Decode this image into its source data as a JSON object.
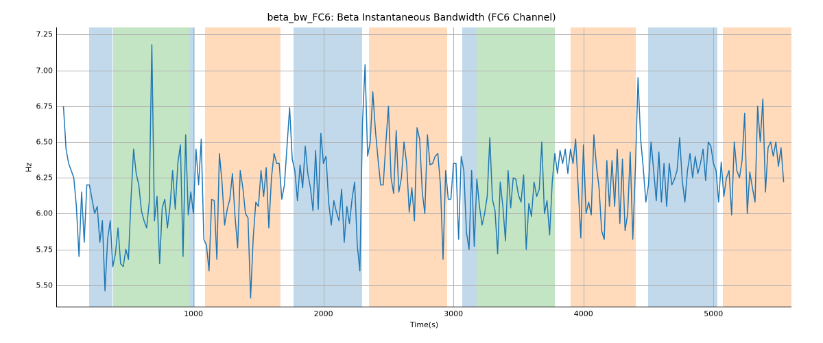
{
  "chart_data": {
    "type": "line",
    "title": "beta_bw_FC6: Beta Instantaneous Bandwidth (FC6 Channel)",
    "xlabel": "Time(s)",
    "ylabel": "Hz",
    "xlim": [
      -50,
      5600
    ],
    "ylim": [
      5.35,
      7.3
    ],
    "xticks": [
      1000,
      2000,
      3000,
      4000,
      5000
    ],
    "yticks": [
      5.5,
      5.75,
      6.0,
      6.25,
      6.5,
      6.75,
      7.0,
      7.25
    ],
    "bands": [
      {
        "color": "blue",
        "x0": 200,
        "x1": 380
      },
      {
        "color": "green",
        "x0": 380,
        "x1": 970
      },
      {
        "color": "blue",
        "x0": 970,
        "x1": 1010
      },
      {
        "color": "orange",
        "x0": 1090,
        "x1": 1670
      },
      {
        "color": "blue",
        "x0": 1770,
        "x1": 2300
      },
      {
        "color": "orange",
        "x0": 2350,
        "x1": 2950
      },
      {
        "color": "blue",
        "x0": 3070,
        "x1": 3180
      },
      {
        "color": "green",
        "x0": 3180,
        "x1": 3780
      },
      {
        "color": "orange",
        "x0": 3900,
        "x1": 4400
      },
      {
        "color": "blue",
        "x0": 4500,
        "x1": 5030
      },
      {
        "color": "orange",
        "x0": 5070,
        "x1": 5600
      }
    ],
    "series": [
      {
        "name": "beta_bw_FC6",
        "x": [
          0,
          20,
          40,
          60,
          80,
          100,
          120,
          140,
          160,
          180,
          200,
          220,
          240,
          260,
          280,
          300,
          320,
          340,
          360,
          380,
          400,
          420,
          440,
          460,
          480,
          500,
          520,
          540,
          560,
          580,
          600,
          620,
          640,
          660,
          680,
          700,
          720,
          740,
          760,
          780,
          800,
          820,
          840,
          860,
          880,
          900,
          920,
          940,
          960,
          980,
          1000,
          1020,
          1040,
          1060,
          1080,
          1100,
          1120,
          1140,
          1160,
          1180,
          1200,
          1220,
          1240,
          1260,
          1280,
          1300,
          1320,
          1340,
          1360,
          1380,
          1400,
          1420,
          1440,
          1460,
          1480,
          1500,
          1520,
          1540,
          1560,
          1580,
          1600,
          1620,
          1640,
          1660,
          1680,
          1700,
          1720,
          1740,
          1760,
          1780,
          1800,
          1820,
          1840,
          1860,
          1880,
          1900,
          1920,
          1940,
          1960,
          1980,
          2000,
          2020,
          2040,
          2060,
          2080,
          2100,
          2120,
          2140,
          2160,
          2180,
          2200,
          2220,
          2240,
          2260,
          2280,
          2300,
          2320,
          2340,
          2360,
          2380,
          2400,
          2420,
          2440,
          2460,
          2480,
          2500,
          2520,
          2540,
          2560,
          2580,
          2600,
          2620,
          2640,
          2660,
          2680,
          2700,
          2720,
          2740,
          2760,
          2780,
          2800,
          2820,
          2840,
          2860,
          2880,
          2900,
          2920,
          2940,
          2960,
          2980,
          3000,
          3020,
          3040,
          3060,
          3080,
          3100,
          3120,
          3140,
          3160,
          3180,
          3200,
          3220,
          3240,
          3260,
          3280,
          3300,
          3320,
          3340,
          3360,
          3380,
          3400,
          3420,
          3440,
          3460,
          3480,
          3500,
          3520,
          3540,
          3560,
          3580,
          3600,
          3620,
          3640,
          3660,
          3680,
          3700,
          3720,
          3740,
          3760,
          3780,
          3800,
          3820,
          3840,
          3860,
          3880,
          3900,
          3920,
          3940,
          3960,
          3980,
          4000,
          4020,
          4040,
          4060,
          4080,
          4100,
          4120,
          4140,
          4160,
          4180,
          4200,
          4220,
          4240,
          4260,
          4280,
          4300,
          4320,
          4340,
          4360,
          4380,
          4400,
          4420,
          4440,
          4460,
          4480,
          4500,
          4520,
          4540,
          4560,
          4580,
          4600,
          4620,
          4640,
          4660,
          4680,
          4700,
          4720,
          4740,
          4760,
          4780,
          4800,
          4820,
          4840,
          4860,
          4880,
          4900,
          4920,
          4940,
          4960,
          4980,
          5000,
          5020,
          5040,
          5060,
          5080,
          5100,
          5120,
          5140,
          5160,
          5180,
          5200,
          5220,
          5240,
          5260,
          5280,
          5300,
          5320,
          5340,
          5360,
          5380,
          5400,
          5420,
          5440,
          5460,
          5480,
          5500,
          5520,
          5540
        ],
        "values": [
          6.75,
          6.45,
          6.35,
          6.3,
          6.25,
          6.05,
          5.7,
          6.15,
          5.8,
          6.2,
          6.2,
          6.1,
          6.0,
          6.05,
          5.8,
          5.95,
          5.46,
          5.82,
          5.95,
          5.63,
          5.72,
          5.9,
          5.65,
          5.63,
          5.75,
          5.68,
          6.1,
          6.45,
          6.28,
          6.2,
          6.02,
          5.95,
          5.9,
          6.08,
          7.18,
          5.95,
          6.12,
          5.65,
          6.04,
          6.1,
          5.9,
          6.05,
          6.3,
          6.03,
          6.35,
          6.48,
          5.7,
          6.55,
          5.99,
          6.15,
          6.0,
          6.45,
          6.2,
          6.52,
          5.82,
          5.78,
          5.6,
          6.1,
          6.09,
          5.68,
          6.42,
          6.22,
          5.92,
          6.03,
          6.1,
          6.28,
          5.98,
          5.76,
          6.3,
          6.18,
          6.0,
          5.97,
          5.41,
          5.83,
          6.08,
          6.05,
          6.3,
          6.12,
          6.32,
          5.9,
          6.25,
          6.42,
          6.35,
          6.35,
          6.1,
          6.2,
          6.47,
          6.74,
          6.38,
          6.3,
          6.09,
          6.34,
          6.18,
          6.47,
          6.28,
          6.18,
          6.02,
          6.44,
          6.03,
          6.56,
          6.35,
          6.4,
          6.08,
          5.92,
          6.09,
          6.01,
          5.95,
          6.17,
          5.8,
          6.05,
          5.93,
          6.1,
          6.22,
          5.78,
          5.6,
          6.63,
          7.04,
          6.4,
          6.5,
          6.85,
          6.58,
          6.38,
          6.2,
          6.2,
          6.49,
          6.75,
          6.25,
          6.14,
          6.58,
          6.15,
          6.25,
          6.5,
          6.35,
          6.01,
          6.18,
          5.95,
          6.6,
          6.52,
          6.15,
          6.0,
          6.55,
          6.34,
          6.35,
          6.4,
          6.42,
          6.2,
          5.68,
          6.3,
          6.1,
          6.1,
          6.35,
          6.35,
          5.82,
          6.4,
          6.3,
          5.87,
          5.75,
          6.3,
          5.77,
          6.24,
          6.05,
          5.92,
          6.0,
          6.12,
          6.53,
          6.1,
          6.02,
          5.72,
          6.22,
          6.05,
          5.81,
          6.3,
          6.04,
          6.25,
          6.24,
          6.13,
          6.08,
          6.27,
          5.75,
          6.07,
          5.98,
          6.22,
          6.12,
          6.17,
          6.5,
          6.0,
          6.09,
          5.85,
          6.22,
          6.42,
          6.28,
          6.44,
          6.35,
          6.45,
          6.28,
          6.45,
          6.35,
          6.52,
          6.18,
          5.83,
          6.48,
          6.0,
          6.08,
          5.99,
          6.55,
          6.33,
          6.18,
          5.88,
          5.82,
          6.37,
          6.05,
          6.37,
          6.05,
          6.45,
          5.93,
          6.38,
          5.88,
          6.0,
          6.43,
          5.82,
          6.32,
          6.95,
          6.52,
          6.32,
          6.08,
          6.2,
          6.5,
          6.3,
          6.09,
          6.43,
          6.08,
          6.35,
          6.05,
          6.35,
          6.2,
          6.24,
          6.3,
          6.53,
          6.23,
          6.08,
          6.3,
          6.42,
          6.25,
          6.4,
          6.28,
          6.35,
          6.45,
          6.23,
          6.5,
          6.47,
          6.35,
          6.3,
          6.08,
          6.36,
          6.12,
          6.25,
          6.3,
          5.99,
          6.5,
          6.3,
          6.25,
          6.37,
          6.7,
          6.0,
          6.29,
          6.18,
          6.08,
          6.75,
          6.5,
          6.8,
          6.15,
          6.46,
          6.5,
          6.4,
          6.5,
          6.33,
          6.46,
          6.22
        ]
      }
    ]
  }
}
